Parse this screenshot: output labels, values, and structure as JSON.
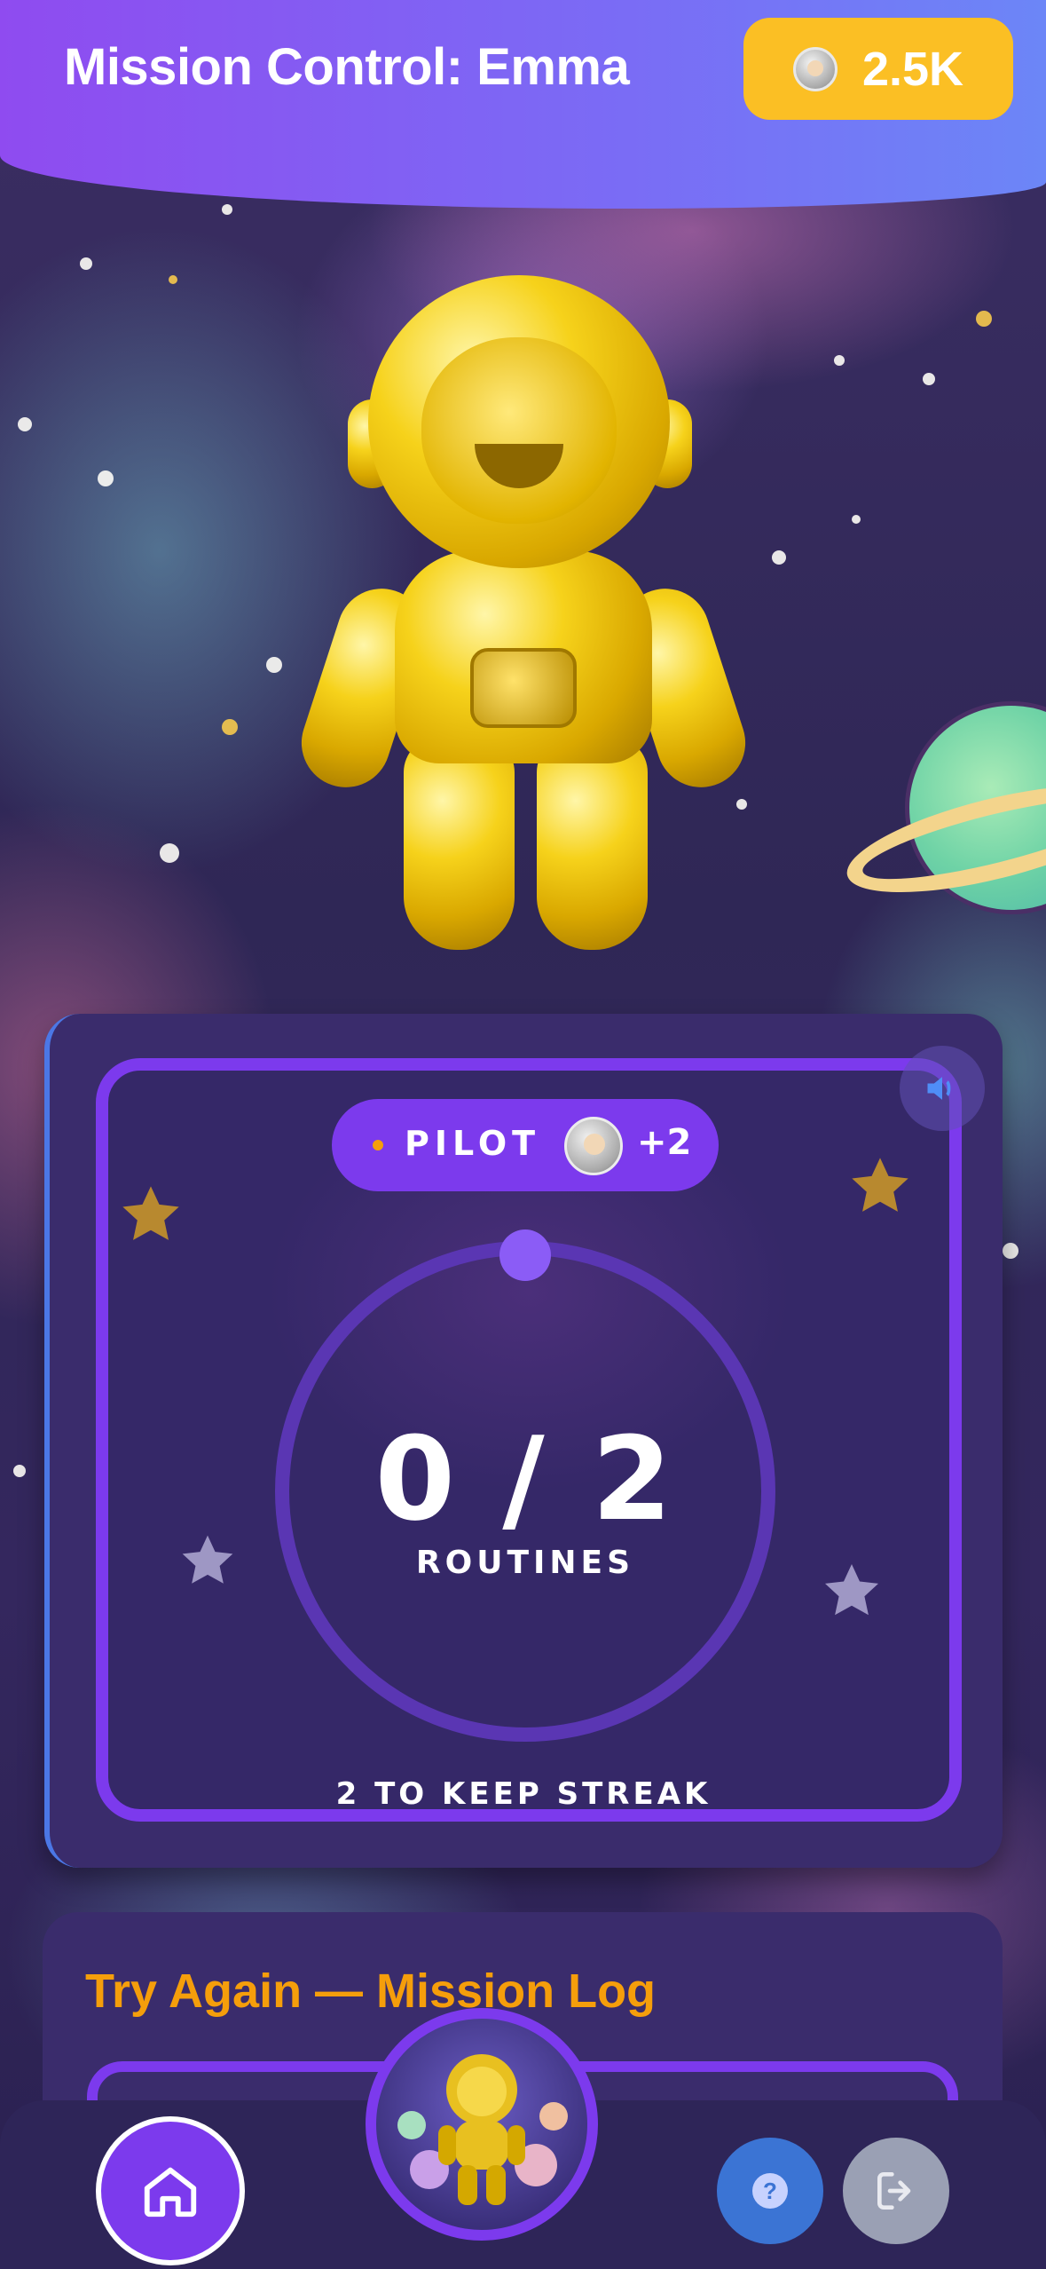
{
  "header": {
    "title": "Mission Control: Emma",
    "coins": "2.5K",
    "coin_icon": "astronaut-avatar-icon"
  },
  "routine_card": {
    "rank_label": "PILOT",
    "extra_count": "+2",
    "progress_text": "0 / 2",
    "progress_completed": 0,
    "progress_total": 2,
    "progress_label": "ROUTINES",
    "streak_text": "2 TO KEEP STREAK",
    "sound_icon": "speaker-icon"
  },
  "mission_log": {
    "title": "Try Again — Mission Log"
  },
  "nav": {
    "home_icon": "home-icon",
    "help_icon": "help-icon",
    "help_glyph": "?",
    "logout_icon": "logout-icon"
  },
  "colors": {
    "header_start": "#8f4bf0",
    "header_end": "#6c86f7",
    "coin_pill": "#fbbf24",
    "accent_purple": "#7c3aed",
    "card_bg": "#3a2c6c",
    "log_title": "#f59e0b",
    "help_button": "#3b74d4",
    "logout_button": "#9aa0b4"
  }
}
